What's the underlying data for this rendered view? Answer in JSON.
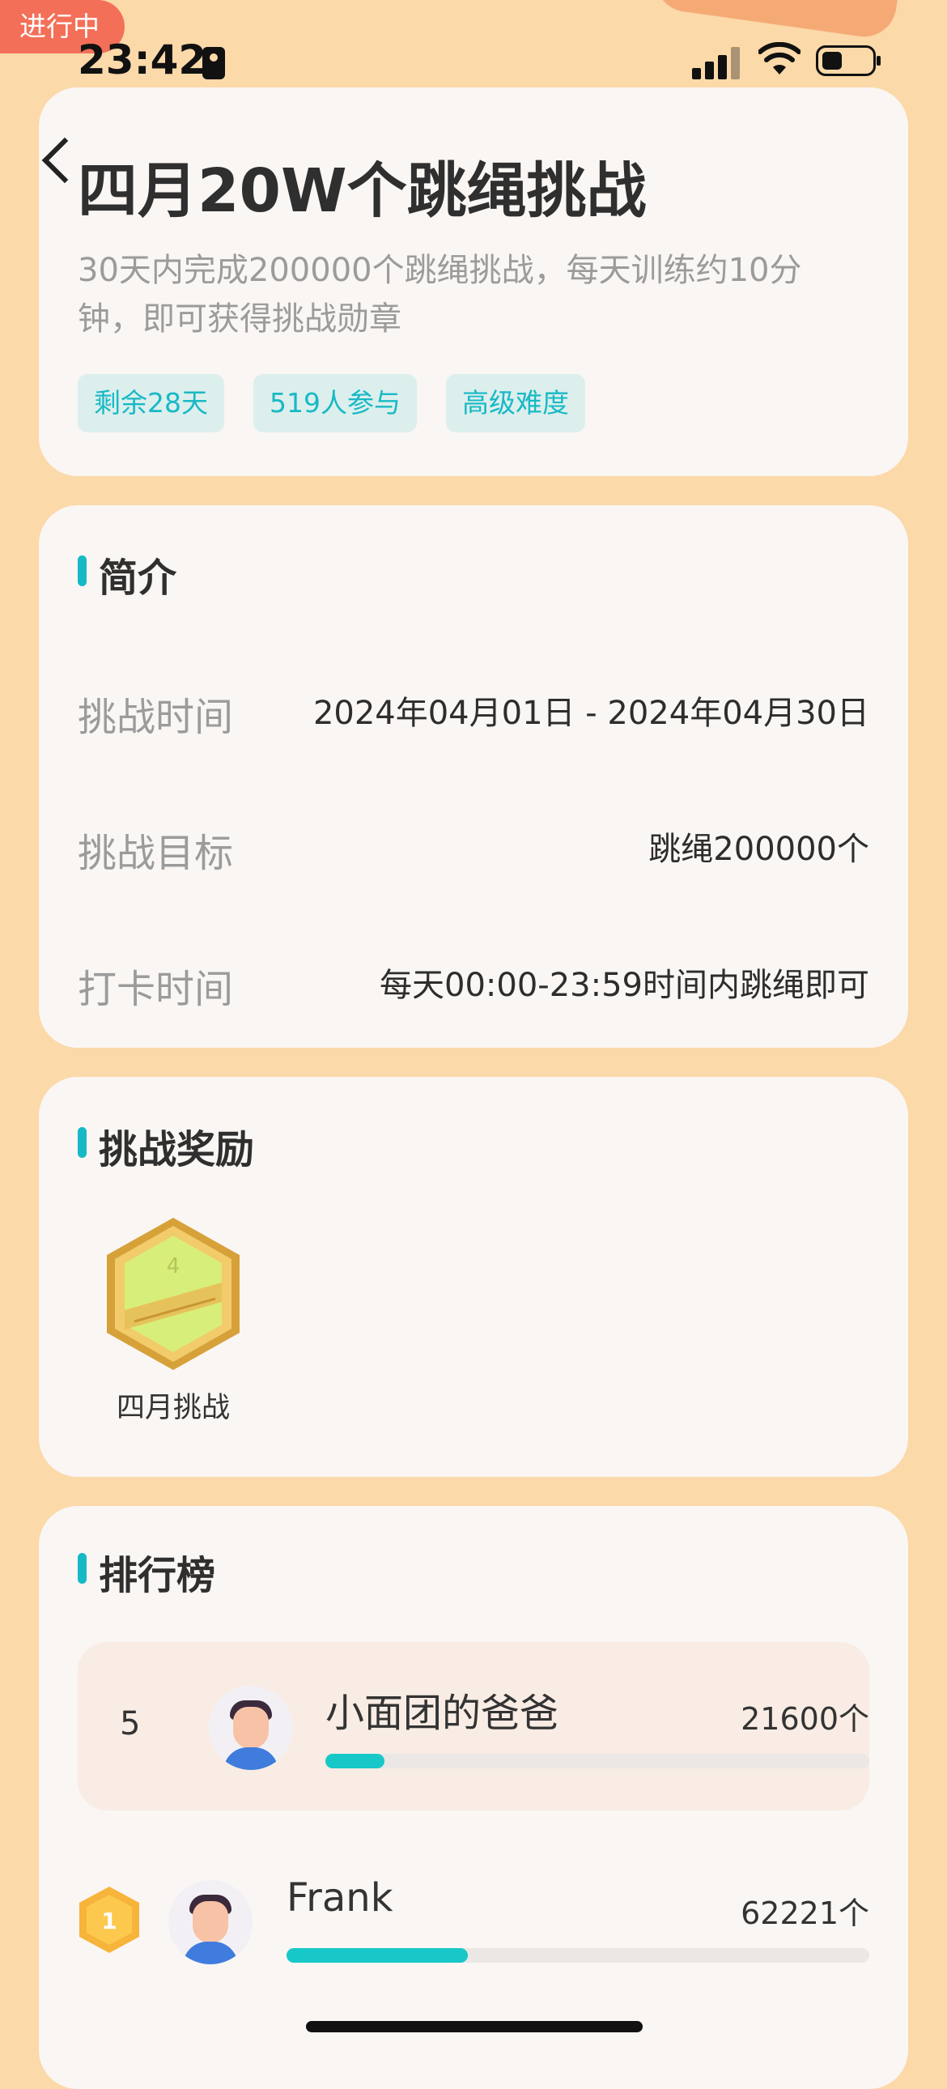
{
  "status_bar": {
    "badge": "进行中",
    "time": "23:42"
  },
  "header": {
    "title": "四月20W个跳绳挑战",
    "description": "30天内完成200000个跳绳挑战，每天训练约10分钟，即可获得挑战勋章",
    "tags": [
      "剩余28天",
      "519人参与",
      "高级难度"
    ]
  },
  "intro": {
    "title": "简介",
    "rows": [
      {
        "label": "挑战时间",
        "value": "2024年04月01日 - 2024年04月30日"
      },
      {
        "label": "挑战目标",
        "value": "跳绳200000个"
      },
      {
        "label": "打卡时间",
        "value": "每天00:00-23:59时间内跳绳即可"
      }
    ]
  },
  "rewards": {
    "title": "挑战奖励",
    "badge_label": "四月挑战"
  },
  "leaderboard": {
    "title": "排行榜",
    "me": {
      "rank": "5",
      "name": "小面团的爸爸",
      "count": "21600个",
      "progress": 0.108
    },
    "entries": [
      {
        "rank": "1",
        "name": "Frank",
        "count": "62221个",
        "progress": 0.311
      }
    ]
  },
  "colors": {
    "background": "#fbd9a9",
    "accent": "#17b9c6",
    "card": "#faf6f3",
    "status_badge": "#f46f58"
  }
}
